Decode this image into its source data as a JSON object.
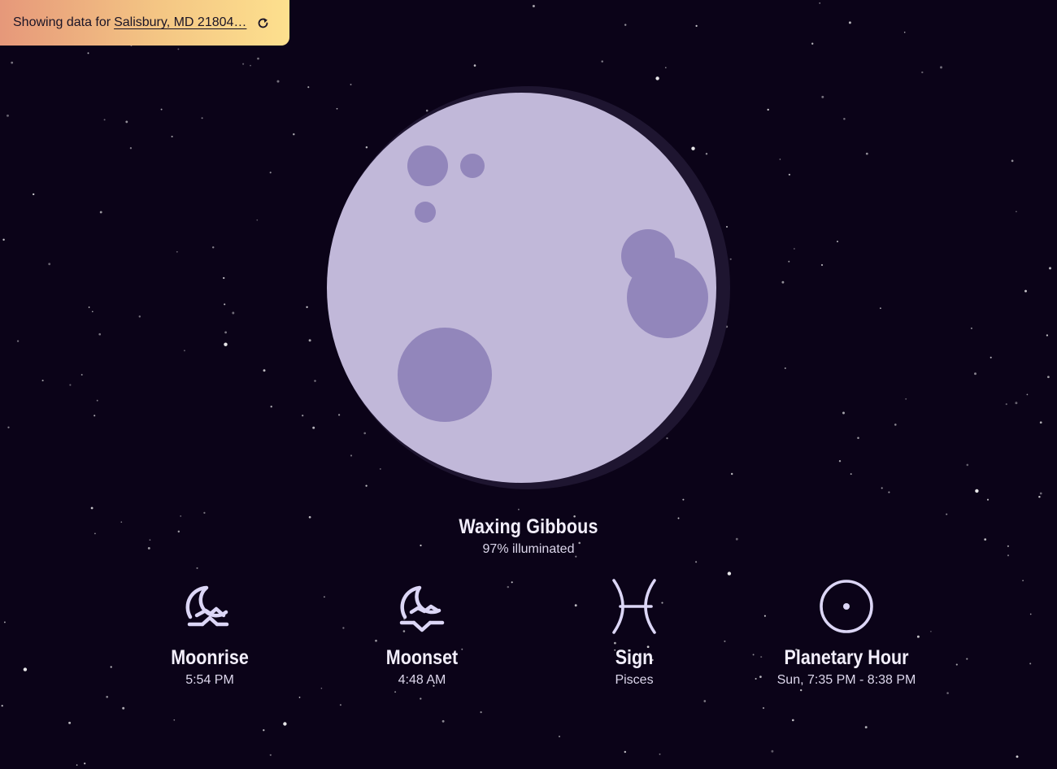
{
  "banner": {
    "prefix": "Showing data for",
    "location": "Salisbury, MD 21804…",
    "refresh_icon": "refresh-icon"
  },
  "moon": {
    "phase": "Waxing Gibbous",
    "illumination_text": "97% illuminated",
    "illumination_fraction": 0.97,
    "colors": {
      "surface": "#c1b8d9",
      "crater": "#9286bb",
      "shadow": "#1e1530",
      "sky": "#0b0318"
    }
  },
  "stats": [
    {
      "id": "moonrise",
      "icon": "moonrise-icon",
      "title": "Moonrise",
      "value": "5:54 PM"
    },
    {
      "id": "moonset",
      "icon": "moonset-icon",
      "title": "Moonset",
      "value": "4:48 AM"
    },
    {
      "id": "sign",
      "icon": "pisces-icon",
      "title": "Sign",
      "value": "Pisces"
    },
    {
      "id": "planetary-hour",
      "icon": "sun-icon",
      "title": "Planetary Hour",
      "value": "Sun, 7:35 PM - 8:38 PM"
    }
  ],
  "colors": {
    "icon_stroke": "#dcd6f6",
    "banner_gradient_start": "#e6987a",
    "banner_gradient_end": "#fde08e"
  }
}
